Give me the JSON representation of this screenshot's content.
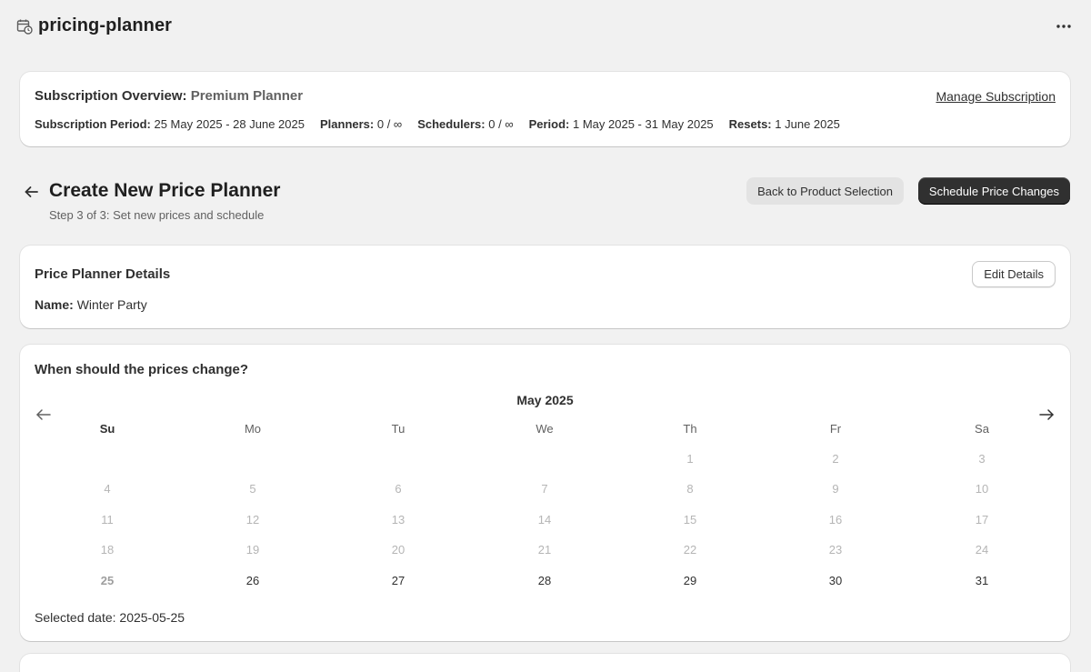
{
  "app": {
    "title": "pricing-planner",
    "icon": "calendar-clock-icon"
  },
  "subscription": {
    "label": "Subscription Overview:",
    "plan": "Premium Planner",
    "manage_link": "Manage Subscription",
    "meta": [
      {
        "label": "Subscription Period:",
        "value": "25 May 2025 - 28 June 2025"
      },
      {
        "label": "Planners:",
        "value": "0 / ∞"
      },
      {
        "label": "Schedulers:",
        "value": "0 / ∞"
      },
      {
        "label": "Period:",
        "value": "1 May 2025 - 31 May 2025"
      },
      {
        "label": "Resets:",
        "value": "1 June 2025"
      }
    ]
  },
  "page": {
    "title": "Create New Price Planner",
    "subtitle": "Step 3 of 3: Set new prices and schedule",
    "back_button": "Back to Product Selection",
    "primary_button": "Schedule Price Changes"
  },
  "details": {
    "title": "Price Planner Details",
    "edit_button": "Edit Details",
    "name_label": "Name:",
    "name_value": "Winter Party"
  },
  "calendar": {
    "question": "When should the prices change?",
    "month": "May 2025",
    "weekdays": [
      "Su",
      "Mo",
      "Tu",
      "We",
      "Th",
      "Fr",
      "Sa"
    ],
    "first_weekday_index": 4,
    "days_in_month": 31,
    "disabled_before": 26,
    "selected_day": 25,
    "selected_label": "Selected date:",
    "selected_value": "2025-05-25"
  },
  "colors": {
    "primary": "#303030",
    "secondary_button": "#e3e3e3",
    "disabled_text": "#b5b5b5"
  }
}
